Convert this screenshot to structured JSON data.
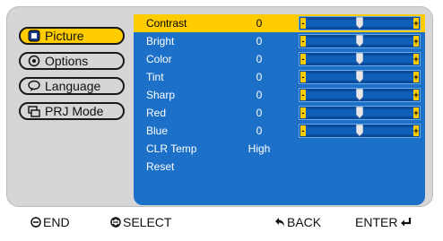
{
  "menu": {
    "items": [
      {
        "label": "Picture",
        "icon": "picture-icon",
        "active": true
      },
      {
        "label": "Options",
        "icon": "options-icon",
        "active": false
      },
      {
        "label": "Language",
        "icon": "language-icon",
        "active": false
      },
      {
        "label": "PRJ Mode",
        "icon": "prj-mode-icon",
        "active": false
      }
    ]
  },
  "settings": {
    "rows": [
      {
        "label": "Contrast",
        "value": "0",
        "slider": true,
        "level": 0.5
      },
      {
        "label": "Bright",
        "value": "0",
        "slider": true,
        "level": 0.5
      },
      {
        "label": "Color",
        "value": "0",
        "slider": true,
        "level": 0.5
      },
      {
        "label": "Tint",
        "value": "0",
        "slider": true,
        "level": 0.5
      },
      {
        "label": "Sharp",
        "value": "0",
        "slider": true,
        "level": 0.5
      },
      {
        "label": "Red",
        "value": "0",
        "slider": true,
        "level": 0.5
      },
      {
        "label": "Blue",
        "value": "0",
        "slider": true,
        "level": 0.5
      },
      {
        "label": "CLR Temp",
        "value": "High",
        "slider": false
      },
      {
        "label": "Reset",
        "value": "",
        "slider": false
      }
    ],
    "selected_index": 0,
    "slider_minus": "-",
    "slider_plus": "+"
  },
  "footer": {
    "end_label": "END",
    "select_label": "SELECT",
    "back_label": "BACK",
    "enter_label": "ENTER"
  },
  "colors": {
    "accent": "#ffcc00",
    "panel": "#1c70c8",
    "frame": "#d6d6d6"
  }
}
